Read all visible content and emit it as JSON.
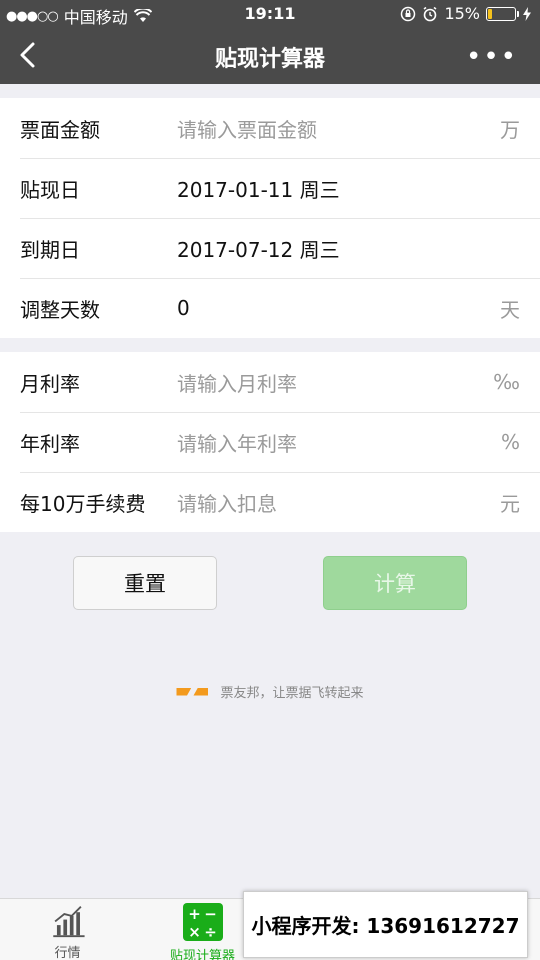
{
  "status_bar": {
    "carrier": "中国移动",
    "time": "19:11",
    "battery": "15%",
    "battery_level": 0.15
  },
  "nav": {
    "title": "贴现计算器",
    "back_icon": "chevron-left-icon",
    "more_icon": "more-dots-icon"
  },
  "form": {
    "group1": [
      {
        "label": "票面金额",
        "placeholder": "请输入票面金额",
        "value": "",
        "unit": "万"
      },
      {
        "label": "贴现日",
        "placeholder": "",
        "value": "2017-01-11 周三",
        "unit": ""
      },
      {
        "label": "到期日",
        "placeholder": "",
        "value": "2017-07-12 周三",
        "unit": ""
      },
      {
        "label": "调整天数",
        "placeholder": "",
        "value": "0",
        "unit": "天"
      }
    ],
    "group2": [
      {
        "label": "月利率",
        "placeholder": "请输入月利率",
        "value": "",
        "unit": "‰"
      },
      {
        "label": "年利率",
        "placeholder": "请输入年利率",
        "value": "",
        "unit": "%"
      },
      {
        "label": "每10万手续费",
        "placeholder": "请输入扣息",
        "value": "",
        "unit": "元"
      }
    ]
  },
  "buttons": {
    "reset": "重置",
    "calculate": "计算"
  },
  "slogan": "票友邦，让票据飞转起来",
  "tabbar": {
    "tab1": "行情",
    "tab2": "贴现计算器",
    "tab3": "",
    "tab4": ""
  },
  "banner": "小程序开发: 13691612727",
  "colors": {
    "nav_bg": "#4a4a4a",
    "accent": "#1aad19",
    "calc_btn": "#9fd99d",
    "logo": "#f39a1d"
  }
}
